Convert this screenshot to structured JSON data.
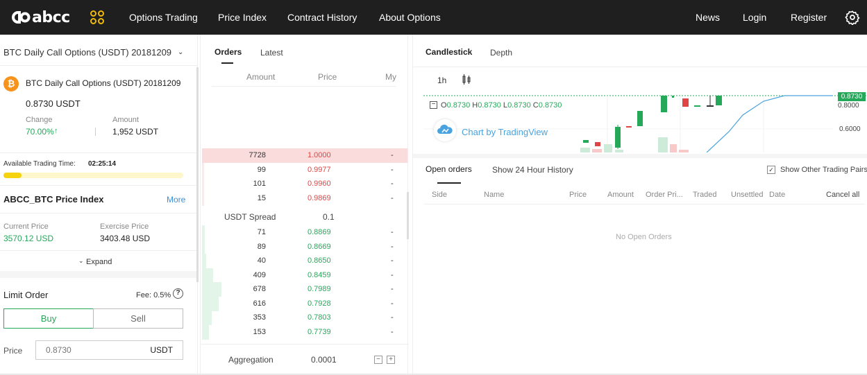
{
  "nav": {
    "logo_text": "abcc",
    "items": [
      "Options Trading",
      "Price Index",
      "Contract History",
      "About Options"
    ],
    "right": [
      "News",
      "Login",
      "Register"
    ]
  },
  "left": {
    "market_select": "BTC Daily Call Options (USDT) 20181209",
    "contract_name": "BTC Daily Call Options (USDT) 20181209",
    "last_price": "0.8730 USDT",
    "change_label": "Change",
    "change_value": "70.00%",
    "amount_label": "Amount",
    "amount_value": "1,952 USDT",
    "available_label": "Available Trading Time:",
    "available_time": "02:25:14",
    "progress_fraction": 0.1,
    "index_title": "ABCC_BTC  Price Index",
    "more_label": "More",
    "current_price_label": "Current Price",
    "current_price": "3570.12 USD",
    "exercise_price_label": "Exercise Price",
    "exercise_price": "3403.48 USD",
    "expand_label": "Expand",
    "limit_order_label": "Limit Order",
    "fee_label": "Fee: 0.5%",
    "buy_label": "Buy",
    "sell_label": "Sell",
    "price_label": "Price",
    "price_placeholder": "0.8730",
    "price_unit": "USDT"
  },
  "orderbook": {
    "tabs": [
      "Orders",
      "Latest"
    ],
    "headers": [
      "Amount",
      "Price",
      "My"
    ],
    "asks": [
      {
        "amount": "7728",
        "price": "1.0000",
        "my": "-"
      },
      {
        "amount": "99",
        "price": "0.9977",
        "my": "-"
      },
      {
        "amount": "101",
        "price": "0.9960",
        "my": "-"
      },
      {
        "amount": "15",
        "price": "0.9869",
        "my": "-"
      }
    ],
    "spread_label": "USDT Spread",
    "spread_value": "0.1",
    "bids": [
      {
        "amount": "71",
        "price": "0.8869",
        "my": "-"
      },
      {
        "amount": "89",
        "price": "0.8669",
        "my": "-"
      },
      {
        "amount": "40",
        "price": "0.8650",
        "my": "-"
      },
      {
        "amount": "409",
        "price": "0.8459",
        "my": "-"
      },
      {
        "amount": "678",
        "price": "0.7989",
        "my": "-"
      },
      {
        "amount": "616",
        "price": "0.7928",
        "my": "-"
      },
      {
        "amount": "353",
        "price": "0.7803",
        "my": "-"
      },
      {
        "amount": "153",
        "price": "0.7739",
        "my": "-"
      }
    ],
    "aggregation_label": "Aggregation",
    "aggregation_value": "0.0001"
  },
  "chart": {
    "tabs": [
      "Candlestick",
      "Depth"
    ],
    "interval": "1h",
    "ohlc": {
      "o": "0.8730",
      "h": "0.8730",
      "l": "0.8730",
      "c": "0.8730"
    },
    "tv_label": "Chart by TradingView",
    "axis_labels": [
      "0.8000",
      "0.6000"
    ],
    "last_price_tag": "0.8730"
  },
  "orders": {
    "tabs": [
      "Open orders",
      "Show 24 Hour History"
    ],
    "show_other_label": "Show Other Trading Pairs",
    "columns": [
      "Side",
      "Name",
      "Price",
      "Amount",
      "Order Pri...",
      "Traded",
      "Unsettled",
      "Date"
    ],
    "cancel_all": "Cancel all",
    "empty": "No Open Orders"
  },
  "colors": {
    "green": "#25a85a",
    "red": "#e04545",
    "nav_bg": "#1f1f1f",
    "accent_yellow": "#f0b90b"
  }
}
